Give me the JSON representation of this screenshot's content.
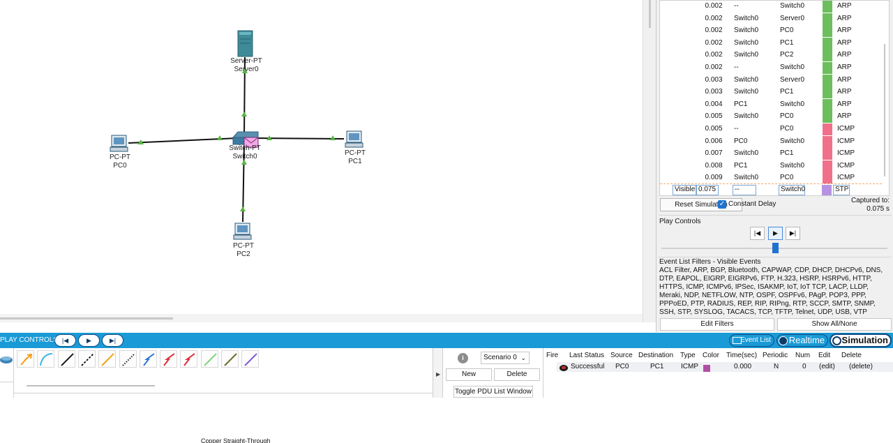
{
  "workspace": {
    "devices": [
      {
        "id": "server0",
        "model": "Server-PT",
        "name": "Server0"
      },
      {
        "id": "switch0",
        "model": "Switch-PT",
        "name": "Switch0"
      },
      {
        "id": "pc0",
        "model": "PC-PT",
        "name": "PC0"
      },
      {
        "id": "pc1",
        "model": "PC-PT",
        "name": "PC1"
      },
      {
        "id": "pc2",
        "model": "PC-PT",
        "name": "PC2"
      }
    ]
  },
  "event_list": {
    "rows": [
      {
        "time": "0.002",
        "last_device": "--",
        "at_device": "Switch0",
        "type": "ARP",
        "color": "#6cbf5c"
      },
      {
        "time": "0.002",
        "last_device": "Switch0",
        "at_device": "Server0",
        "type": "ARP",
        "color": "#6cbf5c"
      },
      {
        "time": "0.002",
        "last_device": "Switch0",
        "at_device": "PC0",
        "type": "ARP",
        "color": "#6cbf5c"
      },
      {
        "time": "0.002",
        "last_device": "Switch0",
        "at_device": "PC1",
        "type": "ARP",
        "color": "#6cbf5c"
      },
      {
        "time": "0.002",
        "last_device": "Switch0",
        "at_device": "PC2",
        "type": "ARP",
        "color": "#6cbf5c"
      },
      {
        "time": "0.002",
        "last_device": "--",
        "at_device": "Switch0",
        "type": "ARP",
        "color": "#6cbf5c"
      },
      {
        "time": "0.003",
        "last_device": "Switch0",
        "at_device": "Server0",
        "type": "ARP",
        "color": "#6cbf5c"
      },
      {
        "time": "0.003",
        "last_device": "Switch0",
        "at_device": "PC1",
        "type": "ARP",
        "color": "#6cbf5c"
      },
      {
        "time": "0.004",
        "last_device": "PC1",
        "at_device": "Switch0",
        "type": "ARP",
        "color": "#6cbf5c"
      },
      {
        "time": "0.005",
        "last_device": "Switch0",
        "at_device": "PC0",
        "type": "ARP",
        "color": "#6cbf5c"
      },
      {
        "time": "0.005",
        "last_device": "--",
        "at_device": "PC0",
        "type": "ICMP",
        "color": "#f07089"
      },
      {
        "time": "0.006",
        "last_device": "PC0",
        "at_device": "Switch0",
        "type": "ICMP",
        "color": "#f07089"
      },
      {
        "time": "0.007",
        "last_device": "Switch0",
        "at_device": "PC1",
        "type": "ICMP",
        "color": "#f07089"
      },
      {
        "time": "0.008",
        "last_device": "PC1",
        "at_device": "Switch0",
        "type": "ICMP",
        "color": "#f07089"
      },
      {
        "time": "0.009",
        "last_device": "Switch0",
        "at_device": "PC0",
        "type": "ICMP",
        "color": "#f07089"
      }
    ],
    "current_row": {
      "visible": "Visible",
      "time": "0.075",
      "last_device": "--",
      "at_device": "Switch0",
      "type": "STP",
      "color": "#b693e0"
    }
  },
  "sim_controls": {
    "reset_label": "Reset Simulation",
    "constant_delay_label": "Constant Delay",
    "captured_label": "Captured to:",
    "captured_value": "0.075 s"
  },
  "play_controls": {
    "title": "Play Controls",
    "back_icon": "step-back-icon",
    "play_icon": "play-icon",
    "forward_icon": "step-forward-icon"
  },
  "event_filters": {
    "title": "Event List Filters - Visible Events",
    "text": "ACL Filter, ARP, BGP, Bluetooth, CAPWAP, CDP, DHCP, DHCPv6, DNS, DTP, EAPOL, EIGRP, EIGRPv6, FTP, H.323, HSRP, HSRPv6, HTTP, HTTPS, ICMP, ICMPv6, IPSec, ISAKMP, IoT, IoT TCP, LACP, LLDP, Meraki, NDP, NETFLOW, NTP, OSPF, OSPFv6, PAgP, POP3, PPP, PPPoED, PTP, RADIUS, REP, RIP, RIPng, RTP, SCCP, SMTP, SNMP, SSH, STP, SYSLOG, TACACS, TCP, TFTP, Telnet, UDP, USB, VTP",
    "edit_label": "Edit Filters",
    "show_all_label": "Show All/None"
  },
  "bottom_bar": {
    "play_controls_label": "PLAY CONTROLS:",
    "event_list_label": "Event List",
    "realtime_label": "Realtime",
    "simulation_label": "Simulation"
  },
  "palette": {
    "cable_caption": "Copper Straight-Through",
    "cables": [
      {
        "name": "automatic-cable-icon",
        "color": "#f2a018"
      },
      {
        "name": "console-cable-icon",
        "color": "#37b4e6"
      },
      {
        "name": "copper-straight-icon",
        "color": "#1a1a1a"
      },
      {
        "name": "copper-cross-icon",
        "color": "#1a1a1a"
      },
      {
        "name": "fiber-icon",
        "color": "#f2a018"
      },
      {
        "name": "phone-cable-icon",
        "color": "#1a1a1a"
      },
      {
        "name": "coaxial-cable-icon",
        "color": "#2f77d6"
      },
      {
        "name": "serial-dce-icon",
        "color": "#e0303a"
      },
      {
        "name": "serial-dte-icon",
        "color": "#e0303a"
      },
      {
        "name": "octal-cable-icon",
        "color": "#7ed47a"
      },
      {
        "name": "iot-custom-cable-icon",
        "color": "#6b6b2a"
      },
      {
        "name": "usb-cable-icon",
        "color": "#7c5bd0"
      }
    ]
  },
  "scenario": {
    "selected": "Scenario 0",
    "new_label": "New",
    "delete_label": "Delete",
    "toggle_label": "Toggle PDU List Window"
  },
  "pdu_list": {
    "headers": [
      "Fire",
      "Last Status",
      "Source",
      "Destination",
      "Type",
      "Color",
      "Time(sec)",
      "Periodic",
      "Num",
      "Edit",
      "Delete"
    ],
    "row": {
      "last_status": "Successful",
      "source": "PC0",
      "destination": "PC1",
      "type": "ICMP",
      "color": "#b14fa2",
      "time": "0.000",
      "periodic": "N",
      "num": "0",
      "edit": "(edit)",
      "delete": "(delete)"
    }
  }
}
